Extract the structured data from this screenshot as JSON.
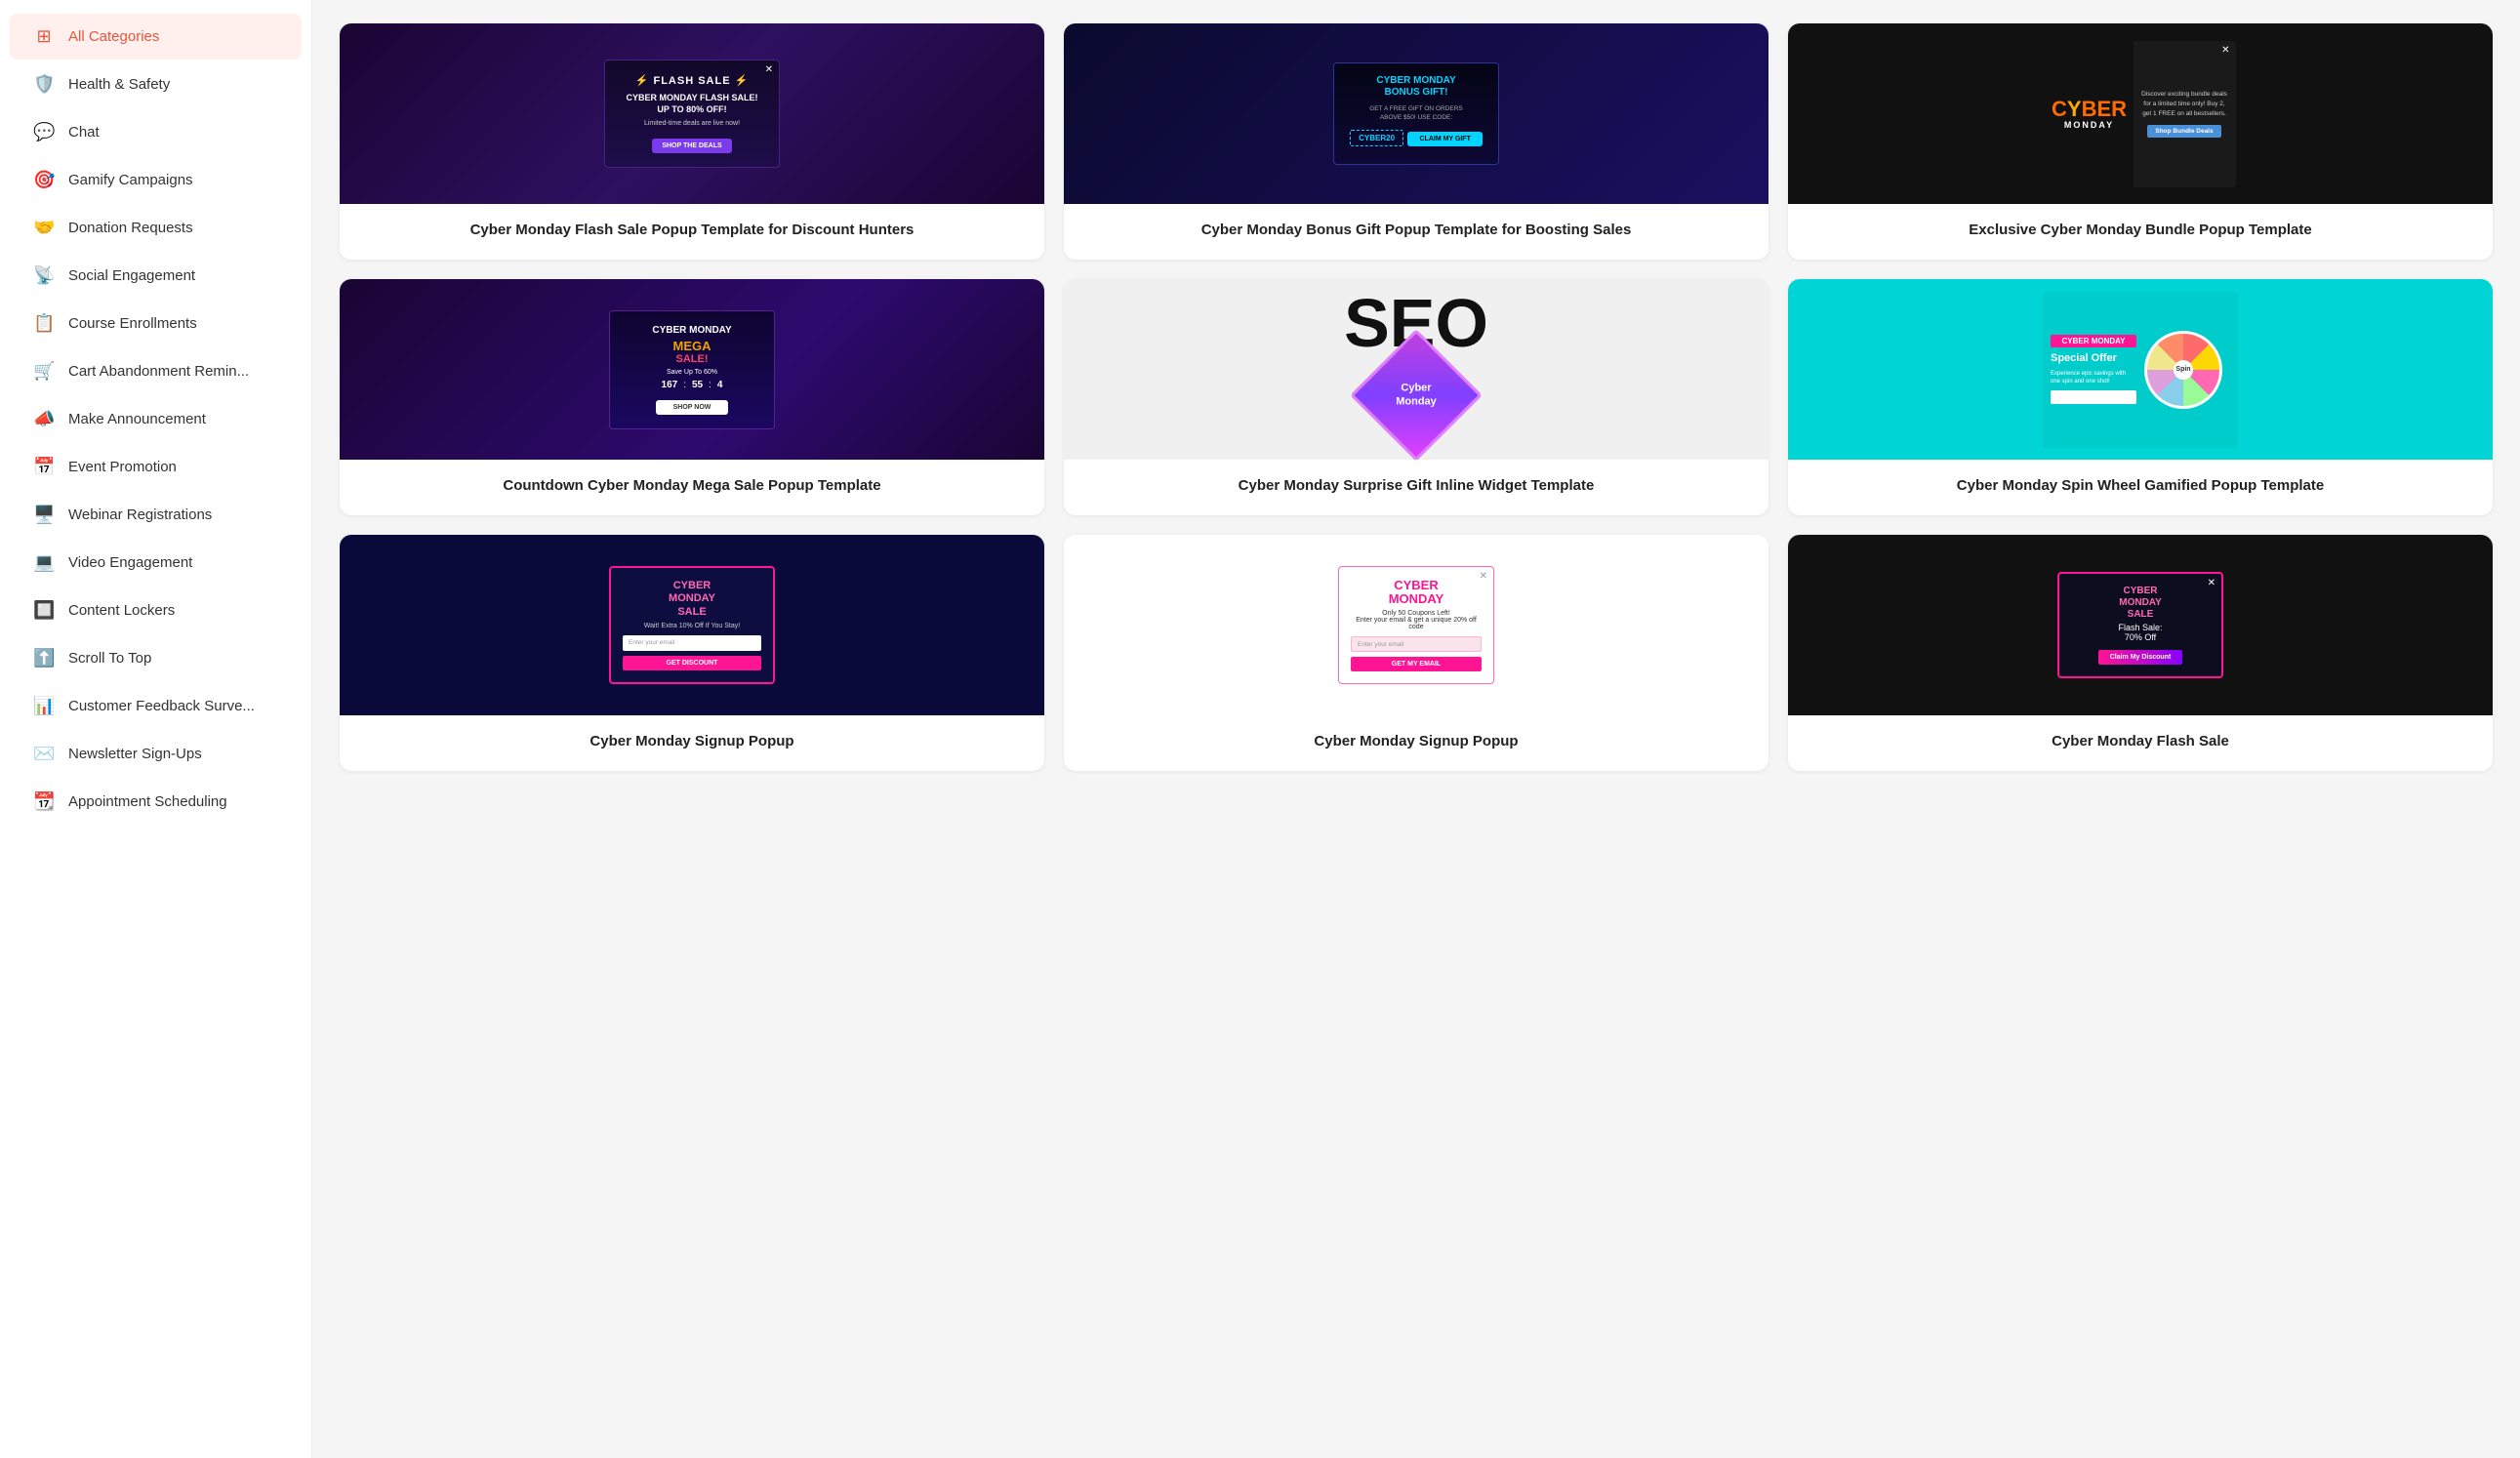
{
  "sidebar": {
    "all_categories_label": "All Categories",
    "items": [
      {
        "id": "health-safety",
        "label": "Health & Safety",
        "icon": "🛡️"
      },
      {
        "id": "chat",
        "label": "Chat",
        "icon": "💬"
      },
      {
        "id": "gamify",
        "label": "Gamify Campaigns",
        "icon": "🎯"
      },
      {
        "id": "donation",
        "label": "Donation Requests",
        "icon": "🤝"
      },
      {
        "id": "social",
        "label": "Social Engagement",
        "icon": "📡"
      },
      {
        "id": "course",
        "label": "Course Enrollments",
        "icon": "📋"
      },
      {
        "id": "cart",
        "label": "Cart Abandonment Remin...",
        "icon": "🛒"
      },
      {
        "id": "announcement",
        "label": "Make Announcement",
        "icon": "📣"
      },
      {
        "id": "event",
        "label": "Event Promotion",
        "icon": "📅"
      },
      {
        "id": "webinar",
        "label": "Webinar Registrations",
        "icon": "🖥️"
      },
      {
        "id": "video",
        "label": "Video Engagement",
        "icon": "💻"
      },
      {
        "id": "content",
        "label": "Content Lockers",
        "icon": "🔲"
      },
      {
        "id": "scroll",
        "label": "Scroll To Top",
        "icon": "⬆️"
      },
      {
        "id": "feedback",
        "label": "Customer Feedback Surve...",
        "icon": "📊"
      },
      {
        "id": "newsletter",
        "label": "Newsletter Sign-Ups",
        "icon": "✉️"
      },
      {
        "id": "appointment",
        "label": "Appointment Scheduling",
        "icon": "📆"
      }
    ]
  },
  "cards": [
    {
      "id": "card-1",
      "title": "Cyber Monday Flash Sale Popup Template for Discount Hunters",
      "preview_type": "flash-sale"
    },
    {
      "id": "card-2",
      "title": "Cyber Monday Bonus Gift Popup Template for Boosting Sales",
      "preview_type": "bonus-gift"
    },
    {
      "id": "card-3",
      "title": "Exclusive Cyber Monday Bundle Popup Template",
      "preview_type": "bundle"
    },
    {
      "id": "card-4",
      "title": "Countdown Cyber Monday Mega Sale Popup Template",
      "preview_type": "countdown"
    },
    {
      "id": "card-5",
      "title": "Cyber Monday Surprise Gift Inline Widget Template",
      "preview_type": "seo"
    },
    {
      "id": "card-6",
      "title": "Cyber Monday Spin Wheel Gamified Popup Template",
      "preview_type": "spin-wheel"
    },
    {
      "id": "card-7",
      "title": "Cyber Monday Signup Popup",
      "preview_type": "signup-dark"
    },
    {
      "id": "card-8",
      "title": "Cyber Monday Signup Popup",
      "preview_type": "signup-light"
    },
    {
      "id": "card-9",
      "title": "Cyber Monday Flash Sale",
      "preview_type": "flash-dark"
    }
  ]
}
